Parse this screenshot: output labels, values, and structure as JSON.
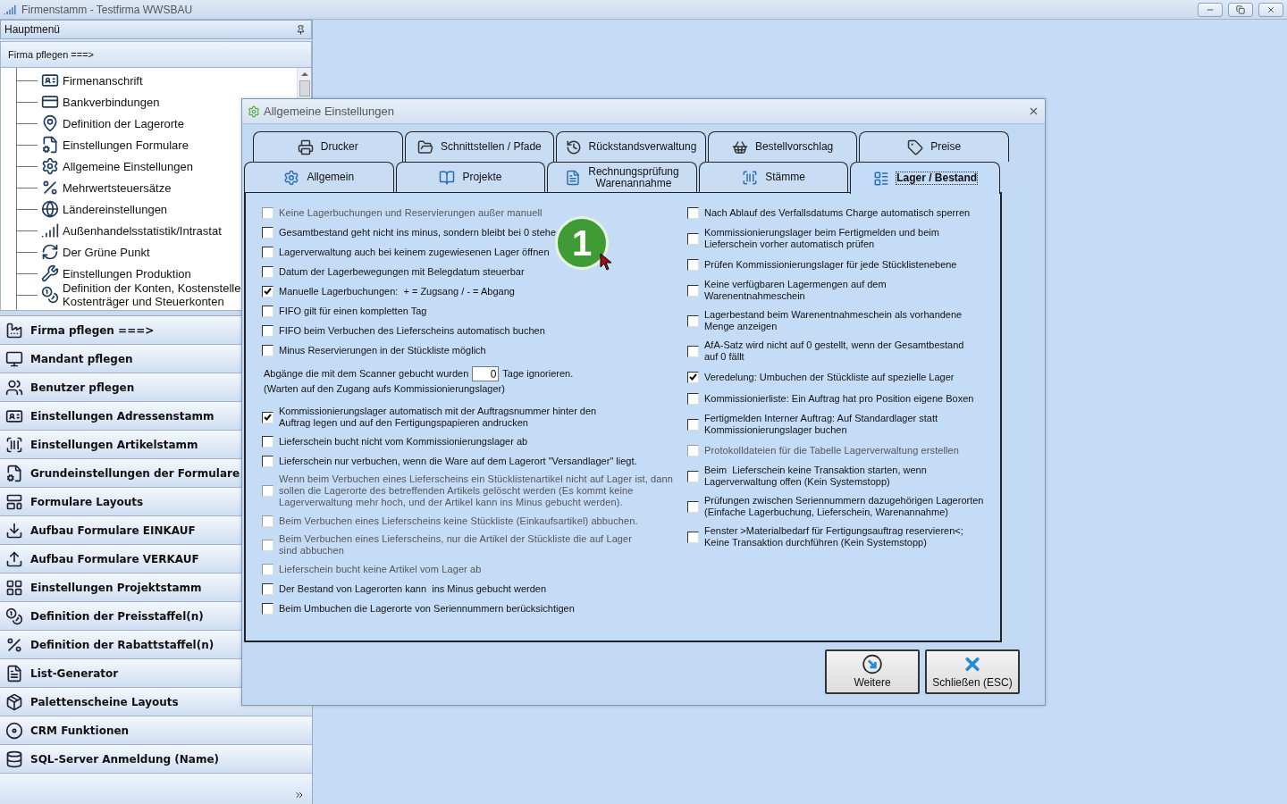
{
  "window": {
    "title": "Firmenstamm - Testfirma WWSBAU"
  },
  "sidebar": {
    "header": "Hauptmenü",
    "section": "Firma pflegen   ===>",
    "tree": [
      "Firmenanschrift",
      "Bankverbindungen",
      "Definition der Lagerorte",
      "Einstellungen Formulare",
      "Allgemeine Einstellungen",
      "Mehrwertsteuersätze",
      "Ländereinstellungen",
      "Außenhandelsstatistik/Intrastat",
      "Der Grüne Punkt",
      "Einstellungen Produktion",
      "Definition der Konten, Kostenstelle\nKostenträger und Steuerkonten"
    ],
    "buttons": [
      "Firma pflegen   ===>",
      "Mandant pflegen",
      "Benutzer pflegen",
      "Einstellungen Adressenstamm",
      "Einstellungen Artikelstamm",
      "Grundeinstellungen der Formulare",
      "Formulare Layouts",
      "Aufbau Formulare EINKAUF",
      "Aufbau Formulare VERKAUF",
      "Einstellungen Projektstamm",
      "Definition der Preisstaffel(n)",
      "Definition der Rabattstaffel(n)",
      "List-Generator",
      "Palettenscheine Layouts",
      "CRM Funktionen",
      "SQL-Server Anmeldung (Name)"
    ]
  },
  "dialog": {
    "title": "Allgemeine Einstellungen",
    "tabs_back": [
      {
        "label": "Drucker",
        "selected": false
      },
      {
        "label": "Schnittstellen / Pfade",
        "selected": false
      },
      {
        "label": "Rückstandsverwaltung",
        "selected": false
      },
      {
        "label": "Bestellvorschlag",
        "selected": false
      },
      {
        "label": "Preise",
        "selected": false
      }
    ],
    "tabs_front": [
      {
        "label": "Allgemein",
        "selected": false
      },
      {
        "label": "Projekte",
        "selected": false
      },
      {
        "label": "Rechnungsprüfung\nWarenannahme",
        "selected": false
      },
      {
        "label": "Stämme",
        "selected": false
      },
      {
        "label": "Lager / Bestand",
        "selected": true
      }
    ],
    "left_options": [
      {
        "kind": "checkbox",
        "label": "Keine Lagerbuchungen und Reservierungen außer manuell",
        "checked": false,
        "disabled": true
      },
      {
        "kind": "checkbox",
        "label": "Gesamtbestand geht nicht ins minus, sondern bleibt bei 0 stehe",
        "checked": false,
        "disabled": false
      },
      {
        "kind": "checkbox",
        "label": "Lagerverwaltung auch bei keinem zugewiesenen Lager öffnen",
        "checked": false,
        "disabled": false
      },
      {
        "kind": "checkbox",
        "label": "Datum der Lagerbewegungen mit Belegdatum steuerbar",
        "checked": false,
        "disabled": false
      },
      {
        "kind": "checkbox",
        "label": "Manuelle Lagerbuchungen:  + = Zugsang / - = Abgang",
        "checked": true,
        "disabled": false
      },
      {
        "kind": "checkbox",
        "label": "FIFO gilt für einen kompletten Tag",
        "checked": false,
        "disabled": false
      },
      {
        "kind": "checkbox",
        "label": "FIFO beim Verbuchen des Lieferscheins automatisch buchen",
        "checked": false,
        "disabled": false
      },
      {
        "kind": "checkbox",
        "label": "Minus Reservierungen in der Stückliste möglich",
        "checked": false,
        "disabled": false
      },
      {
        "kind": "scanner",
        "before": "Abgänge die mit dem Scanner gebucht wurden",
        "value": "0",
        "after": "Tage ignorieren.",
        "note": "(Warten auf den Zugang aufs Kommissionierungslager)"
      },
      {
        "kind": "checkbox",
        "label": "Kommissionierungslager automatisch mit der Auftragsnummer hinter den\nAuftrag legen und auf den Fertigungspapieren andrucken",
        "checked": true,
        "disabled": false
      },
      {
        "kind": "checkbox",
        "label": "Lieferschein bucht nicht vom Kommissionierungslager ab",
        "checked": false,
        "disabled": false
      },
      {
        "kind": "checkbox",
        "label": "Lieferschein nur verbuchen, wenn die Ware auf dem Lagerort \"Versandlager\" liegt.",
        "checked": false,
        "disabled": false
      },
      {
        "kind": "checkbox",
        "label": "Wenn beim Verbuchen eines Lieferscheins ein Stücklistenartikel nicht auf Lager ist, dann\nsollen die Lagerorte des betreffenden Artikels gelöscht werden (Es kommt keine\nLagerverwaltung mehr hoch, und der Artikel kann ins Minus gebucht werden).",
        "checked": false,
        "disabled": true
      },
      {
        "kind": "checkbox",
        "label": "Beim Verbuchen eines Lieferscheins keine Stückliste (Einkaufsartikel) abbuchen.",
        "checked": false,
        "disabled": true
      },
      {
        "kind": "checkbox",
        "label": "Beim Verbuchen eines Lieferscheins, nur die Artikel der Stückliste die auf Lager\nsind abbuchen",
        "checked": false,
        "disabled": true
      },
      {
        "kind": "checkbox",
        "label": "Lieferschein bucht keine Artikel vom Lager ab",
        "checked": false,
        "disabled": true
      },
      {
        "kind": "checkbox",
        "label": "Der Bestand von Lagerorten kann  ins Minus gebucht werden",
        "checked": false,
        "disabled": false
      },
      {
        "kind": "checkbox",
        "label": "Beim Umbuchen die Lagerorte von Seriennummern berücksichtigen",
        "checked": false,
        "disabled": false
      }
    ],
    "right_options": [
      {
        "label": "Nach Ablauf des Verfallsdatums Charge automatisch sperren",
        "checked": false,
        "disabled": false
      },
      {
        "label": "Kommissionierungslager beim Fertigmelden und beim\nLieferschein vorher automatisch prüfen",
        "checked": false,
        "disabled": false
      },
      {
        "label": "Prüfen Kommissionierungslager für jede Stücklistenebene",
        "checked": false,
        "disabled": false
      },
      {
        "label": "Keine verfügbaren Lagermengen auf dem\nWarenentnahmeschein",
        "checked": false,
        "disabled": false
      },
      {
        "label": "Lagerbestand beim Warenentnahmeschein als vorhandene\nMenge anzeigen",
        "checked": false,
        "disabled": false
      },
      {
        "label": "AfA-Satz wird nicht auf 0 gestellt, wenn der Gesamtbestand\nauf 0 fällt",
        "checked": false,
        "disabled": false
      },
      {
        "label": "Veredelung: Umbuchen der Stückliste auf spezielle Lager",
        "checked": true,
        "disabled": false
      },
      {
        "label": "Kommissionierliste: Ein Auftrag hat pro Position eigene Boxen",
        "checked": false,
        "disabled": false
      },
      {
        "label": "Fertigmelden Interner Auftrag: Auf Standardlager statt\nKommissionierungslager buchen",
        "checked": false,
        "disabled": false
      },
      {
        "label": "Protokolldateien für die Tabelle Lagerverwaltung erstellen",
        "checked": false,
        "disabled": true
      },
      {
        "label": "Beim  Lieferschein keine Transaktion starten, wenn\nLagerverwaltung offen (Kein Systemstopp)",
        "checked": false,
        "disabled": false
      },
      {
        "label": "Prüfungen zwischen Seriennummern dazugehörigen Lagerorten\n(Einfache Lagerbuchung, Lieferschein, Warenannahme)",
        "checked": false,
        "disabled": false
      },
      {
        "label": "Fenster >Materialbedarf für Fertigungsauftrag reservieren<;\nKeine Transaktion durchführen (Kein Systemstopp)",
        "checked": false,
        "disabled": false
      }
    ],
    "buttons": [
      "Weitere",
      "Schließen (ESC)"
    ],
    "annotation_badge": "1"
  }
}
